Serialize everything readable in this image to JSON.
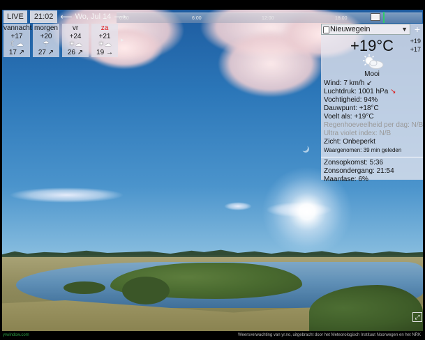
{
  "topbar": {
    "live_label": "LIVE",
    "time": "21:02",
    "prev_arrow": "⟵",
    "date": "Wo, Jul 14",
    "next_arrow": "⟶"
  },
  "timeline": {
    "labels": [
      "0:00",
      "6:00",
      "12:00",
      "18:00"
    ]
  },
  "forecast": [
    {
      "name": "vannacht",
      "hi": "+17",
      "icon": "moon-cloud-icon",
      "lo": "17 ↗",
      "red": false
    },
    {
      "name": "morgen",
      "hi": "+20",
      "icon": "rain-cloud-icon",
      "lo": "27 ↗",
      "red": false
    },
    {
      "name": "vr",
      "hi": "+24",
      "icon": "partly-cloudy-icon",
      "lo": "26 ↗",
      "red": false
    },
    {
      "name": "za",
      "hi": "+21",
      "icon": "partly-cloudy-icon",
      "lo": "19 →",
      "red": true
    }
  ],
  "forecast_next": "▸",
  "panel": {
    "location": "Nieuwegein",
    "temperature": "+19°C",
    "max": "+19",
    "min": "+17",
    "condition": "Mooi",
    "condition_icon": "sun-cloud-icon",
    "details": [
      {
        "text": "Wind:  7 km/h ↙",
        "dim": false,
        "small": false
      },
      {
        "text": "Luchtdruk:  1001 hPa",
        "dim": false,
        "small": false,
        "trend": "↘"
      },
      {
        "text": "Vochtigheid:  94%",
        "dim": false,
        "small": false
      },
      {
        "text": "Dauwpunt:  +18°C",
        "dim": false,
        "small": false
      },
      {
        "text": "Voelt als:  +19°C",
        "dim": false,
        "small": false
      },
      {
        "text": "Regenhoeveelheid per dag:  N/B",
        "dim": true,
        "small": false
      },
      {
        "text": "Ultra violet index:  N/B",
        "dim": true,
        "small": false
      },
      {
        "text": "Zicht:  Onbeperkt",
        "dim": false,
        "small": false
      },
      {
        "text": "Waargenomen:  39 min geleden",
        "dim": false,
        "small": true
      }
    ],
    "astro": [
      "Zonsopkomst:  5:36",
      "Zonsondergang:  21:54",
      "Maanfase:  6%"
    ]
  },
  "footer": {
    "site": "yrwindow.com",
    "credit": "Weersverwachting van yr.no, uitgebracht door het Meteorologisch Instituut Noorwegen en het NRK"
  },
  "colors": {
    "accent_green": "#2fc96b",
    "weekend_red": "#dd1111"
  }
}
